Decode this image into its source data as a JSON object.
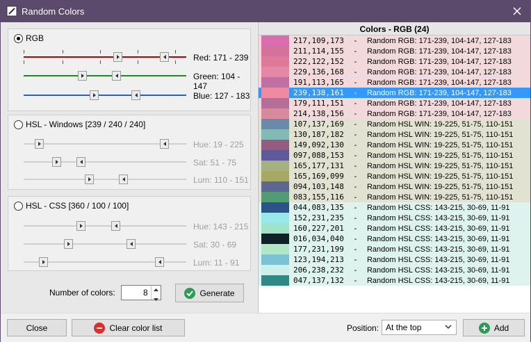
{
  "window": {
    "title": "Random Colors",
    "close_icon": "close-icon",
    "app_icon": "eyedropper-icon"
  },
  "rgb": {
    "label": "RGB",
    "selected": true,
    "red": "Red: 171 - 239",
    "green": "Green: 104 - 147",
    "blue": "Blue: 127 - 183"
  },
  "hsl_win": {
    "label": "HSL - Windows [239 / 240 / 240]",
    "selected": false,
    "hue": "Hue: 19 - 225",
    "sat": "Sat: 51 - 75",
    "lum": "Lum: 110 - 151"
  },
  "hsl_css": {
    "label": "HSL - CSS [360 / 100 / 100]",
    "selected": false,
    "hue": "Hue: 143 - 215",
    "sat": "Sat: 30 - 69",
    "lum": "Lum: 11 - 91"
  },
  "number": {
    "label": "Number of colors:",
    "value": "8"
  },
  "buttons": {
    "generate": "Generate",
    "close": "Close",
    "clear": "Clear color list",
    "add": "Add"
  },
  "position": {
    "label": "Position:",
    "value": "At the top"
  },
  "list": {
    "header": "Colors - RGB (24)",
    "rows": [
      {
        "rgb": "217,109,173",
        "desc": "Random RGB: 171-239, 104-147, 127-183",
        "color": "#d96dad",
        "bg": "#f2dadc"
      },
      {
        "rgb": "211,114,155",
        "desc": "Random RGB: 171-239, 104-147, 127-183",
        "color": "#d3729b",
        "bg": "#f2dadc"
      },
      {
        "rgb": "222,122,152",
        "desc": "Random RGB: 171-239, 104-147, 127-183",
        "color": "#de7a98",
        "bg": "#f2dadc"
      },
      {
        "rgb": "229,136,168",
        "desc": "Random RGB: 171-239, 104-147, 127-183",
        "color": "#e588a8",
        "bg": "#f2dadc"
      },
      {
        "rgb": "191,113,165",
        "desc": "Random RGB: 171-239, 104-147, 127-183",
        "color": "#bf71a5",
        "bg": "#f2dadc"
      },
      {
        "rgb": "239,138,161",
        "desc": "Random RGB: 171-239, 104-147, 127-183",
        "color": "#ef8aa1",
        "bg": "#3399ff",
        "selected": true
      },
      {
        "rgb": "179,111,151",
        "desc": "Random RGB: 171-239, 104-147, 127-183",
        "color": "#b36f97",
        "bg": "#f2dadc"
      },
      {
        "rgb": "214,138,156",
        "desc": "Random RGB: 171-239, 104-147, 127-183",
        "color": "#d68a9c",
        "bg": "#f2dadc"
      },
      {
        "rgb": "107,137,169",
        "desc": "Random HSL WIN: 19-225, 51-75, 110-151",
        "color": "#6b89a9",
        "bg": "#e2e2d2"
      },
      {
        "rgb": "130,187,182",
        "desc": "Random HSL WIN: 19-225, 51-75, 110-151",
        "color": "#82bbb6",
        "bg": "#e2e2d2"
      },
      {
        "rgb": "149,092,130",
        "desc": "Random HSL WIN: 19-225, 51-75, 110-151",
        "color": "#955c82",
        "bg": "#e2e2d2"
      },
      {
        "rgb": "097,088,153",
        "desc": "Random HSL WIN: 19-225, 51-75, 110-151",
        "color": "#615899",
        "bg": "#e2e2d2"
      },
      {
        "rgb": "165,177,131",
        "desc": "Random HSL WIN: 19-225, 51-75, 110-151",
        "color": "#a5b183",
        "bg": "#e2e2d2"
      },
      {
        "rgb": "165,169,099",
        "desc": "Random HSL WIN: 19-225, 51-75, 110-151",
        "color": "#a5a963",
        "bg": "#e2e2d2"
      },
      {
        "rgb": "094,103,148",
        "desc": "Random HSL WIN: 19-225, 51-75, 110-151",
        "color": "#5e6794",
        "bg": "#e2e2d2"
      },
      {
        "rgb": "083,155,116",
        "desc": "Random HSL WIN: 19-225, 51-75, 110-151",
        "color": "#539b74",
        "bg": "#e2e2d2"
      },
      {
        "rgb": "044,083,135",
        "desc": "Random HSL CSS: 143-215, 30-69, 11-91",
        "color": "#2c5387",
        "bg": "#def2ee"
      },
      {
        "rgb": "152,231,235",
        "desc": "Random HSL CSS: 143-215, 30-69, 11-91",
        "color": "#98e7eb",
        "bg": "#def2ee"
      },
      {
        "rgb": "160,227,201",
        "desc": "Random HSL CSS: 143-215, 30-69, 11-91",
        "color": "#a0e3c9",
        "bg": "#def2ee"
      },
      {
        "rgb": "016,034,040",
        "desc": "Random HSL CSS: 143-215, 30-69, 11-91",
        "color": "#102228",
        "bg": "#def2ee"
      },
      {
        "rgb": "177,231,199",
        "desc": "Random HSL CSS: 143-215, 30-69, 11-91",
        "color": "#b1e7c7",
        "bg": "#def2ee"
      },
      {
        "rgb": "123,194,213",
        "desc": "Random HSL CSS: 143-215, 30-69, 11-91",
        "color": "#7bc2d5",
        "bg": "#def2ee"
      },
      {
        "rgb": "206,238,232",
        "desc": "Random HSL CSS: 143-215, 30-69, 11-91",
        "color": "#ceeee8",
        "bg": "#def2ee"
      },
      {
        "rgb": "047,137,132",
        "desc": "Random HSL CSS: 143-215, 30-69, 11-91",
        "color": "#2f8984",
        "bg": "#def2ee"
      }
    ]
  }
}
